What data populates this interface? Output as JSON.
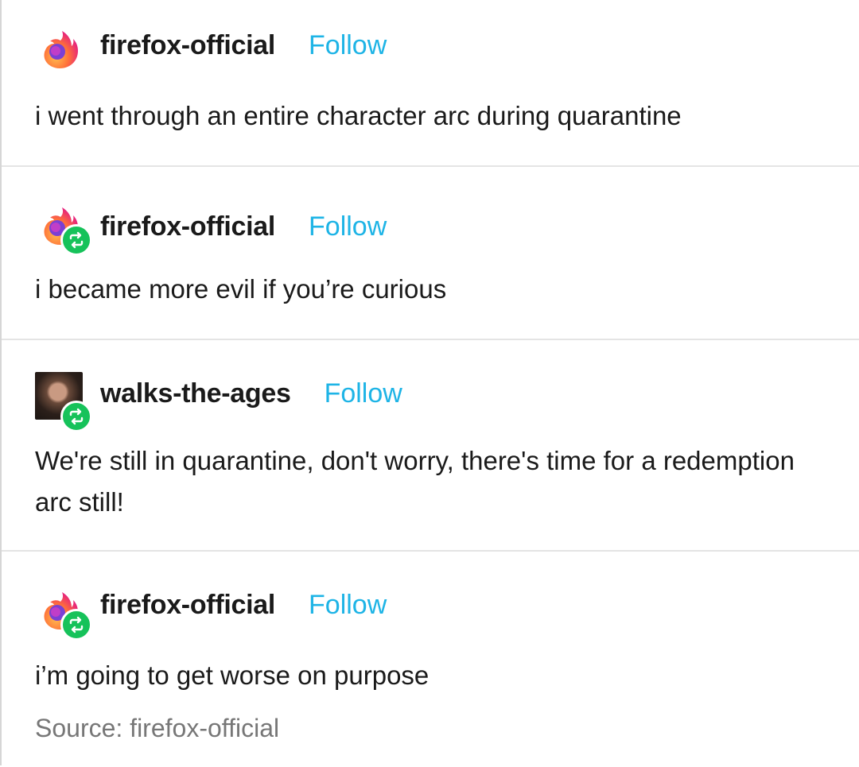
{
  "posts": [
    {
      "username": "firefox-official",
      "follow_label": "Follow",
      "avatar": "firefox-logo",
      "reblog": false,
      "text": "i went through an entire character arc during quarantine"
    },
    {
      "username": "firefox-official",
      "follow_label": "Follow",
      "avatar": "firefox-logo",
      "reblog": true,
      "text": "i became more evil if you’re curious"
    },
    {
      "username": "walks-the-ages",
      "follow_label": "Follow",
      "avatar": "user-photo",
      "reblog": true,
      "text": "We're still in quarantine, don't worry, there's time for a redemption arc still!"
    },
    {
      "username": "firefox-official",
      "follow_label": "Follow",
      "avatar": "firefox-logo",
      "reblog": true,
      "text": "i’m going to get worse on purpose"
    }
  ],
  "source": {
    "label": "Source: firefox-official"
  },
  "colors": {
    "follow": "#1eb4e6",
    "reblog_badge": "#16c25a",
    "source_text": "#777777"
  }
}
